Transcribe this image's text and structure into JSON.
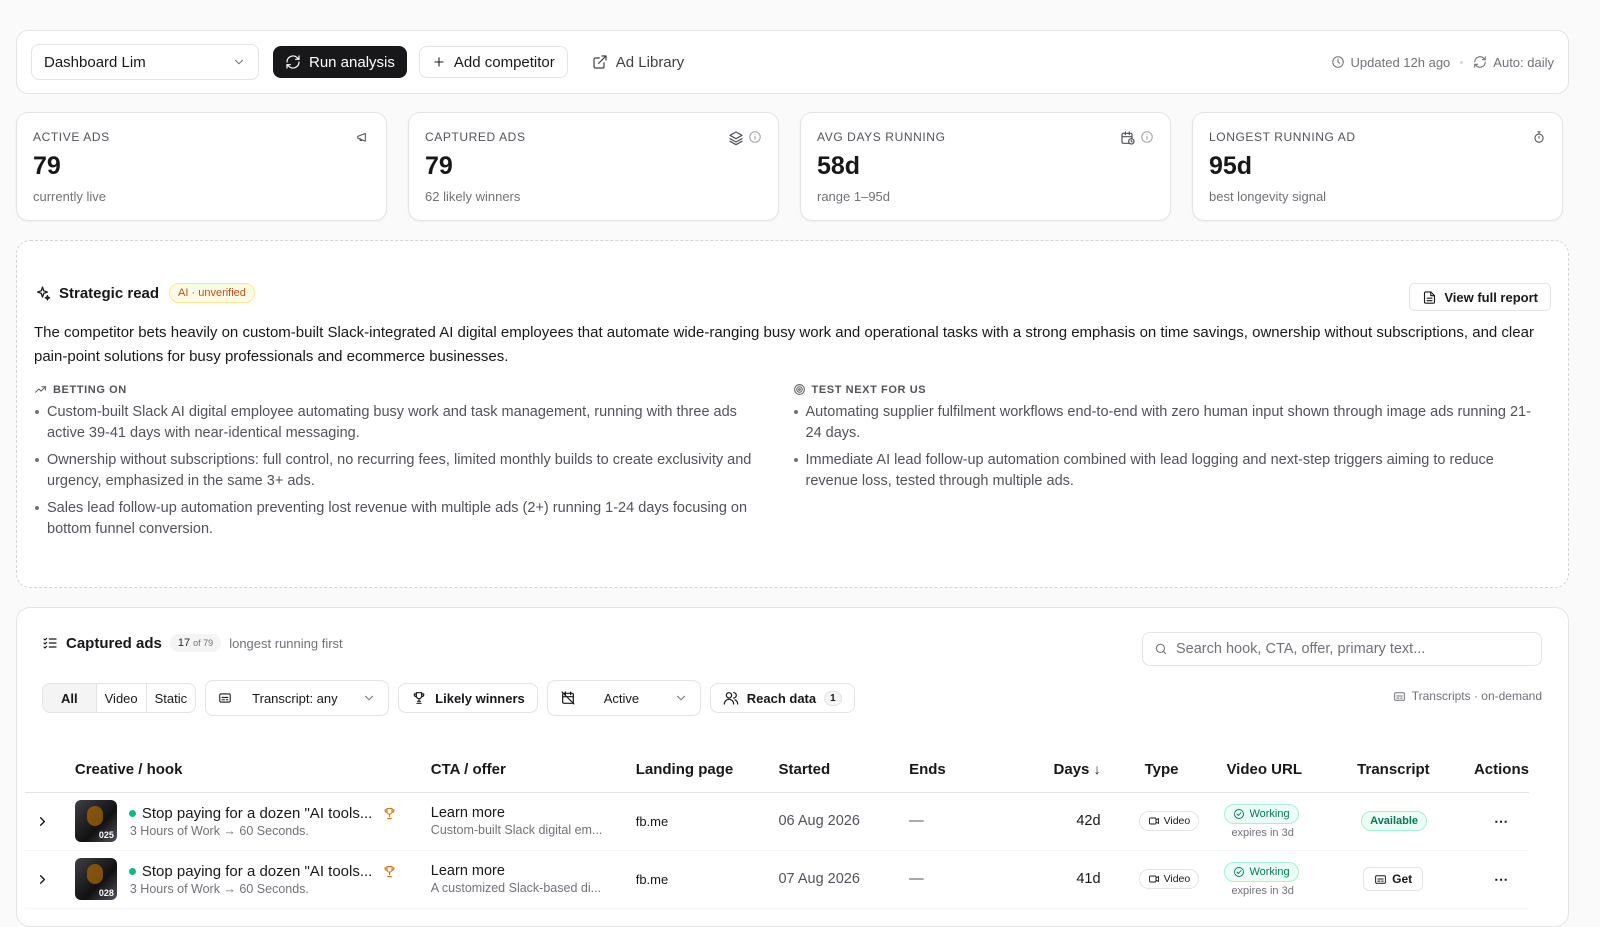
{
  "toolbar": {
    "dashboard_select": "Dashboard Lim",
    "run_analysis": "Run analysis",
    "add_competitor": "Add competitor",
    "ad_library": "Ad Library",
    "updated": "Updated 12h ago",
    "auto": "Auto: daily"
  },
  "stats": [
    {
      "label": "Active ads",
      "value": "79",
      "sub": "currently live",
      "icons": [
        "megaphone-icon"
      ]
    },
    {
      "label": "Captured ads",
      "value": "79",
      "sub": "62 likely winners",
      "icons": [
        "layers-icon",
        "info-icon"
      ]
    },
    {
      "label": "Avg days running",
      "value": "58d",
      "sub": "range 1–95d",
      "icons": [
        "calendar-clock-icon",
        "info-icon"
      ]
    },
    {
      "label": "Longest running ad",
      "value": "95d",
      "sub": "best longevity signal",
      "icons": [
        "stopwatch-icon"
      ]
    }
  ],
  "strategic": {
    "title": "Strategic read",
    "badge": "AI · unverified",
    "view_report": "View full report",
    "summary": "The competitor bets heavily on custom-built Slack-integrated AI digital employees that automate wide-ranging busy work and operational tasks with a strong emphasis on time savings, ownership without subscriptions, and clear pain-point solutions for busy professionals and ecommerce businesses.",
    "betting_on": {
      "label": "BETTING ON",
      "items": [
        "Custom-built Slack AI digital employee automating busy work and task management, running with three ads active 39-41 days with near-identical messaging.",
        "Ownership without subscriptions: full control, no recurring fees, limited monthly builds to create exclusivity and urgency, emphasized in the same 3+ ads.",
        "Sales lead follow-up automation preventing lost revenue with multiple ads (2+) running 1-24 days focusing on bottom funnel conversion."
      ]
    },
    "test_next": {
      "label": "TEST NEXT FOR US",
      "items": [
        "Automating supplier fulfilment workflows end-to-end with zero human input shown through image ads running 21-24 days.",
        "Immediate AI lead follow-up automation combined with lead logging and next-step triggers aiming to reduce revenue loss, tested through multiple ads."
      ]
    }
  },
  "captured": {
    "title": "Captured ads",
    "count": "17",
    "count_of": "of 79",
    "subtitle": "longest running first",
    "search_placeholder": "Search hook, CTA, offer, primary text...",
    "filters": {
      "all": "All",
      "video": "Video",
      "static": "Static",
      "transcript": "Transcript: any",
      "likely_winners": "Likely winners",
      "status": "Active",
      "reach": "Reach data",
      "reach_count": "1"
    },
    "transcripts_note": "Transcripts · on-demand",
    "columns": [
      "Creative / hook",
      "CTA / offer",
      "Landing page",
      "Started",
      "Ends",
      "Days",
      "Type",
      "Video URL",
      "Transcript",
      "Actions"
    ],
    "rows": [
      {
        "thumb_num": "025",
        "hook": "Stop paying for a dozen \"AI tools...",
        "hook_sub": "3 Hours of Work → 60 Seconds.",
        "cta": "Learn more",
        "cta_sub": "Custom-built Slack digital em...",
        "landing": "fb.me",
        "started": "06 Aug 2026",
        "ends": "—",
        "days": "42d",
        "type": "Video",
        "video_status": "Working",
        "expires": "expires in 3d",
        "transcript": "Available"
      },
      {
        "thumb_num": "028",
        "hook": "Stop paying for a dozen \"AI tools...",
        "hook_sub": "3 Hours of Work → 60 Seconds.",
        "cta": "Learn more",
        "cta_sub": "A customized Slack-based di...",
        "landing": "fb.me",
        "started": "07 Aug 2026",
        "ends": "—",
        "days": "41d",
        "type": "Video",
        "video_status": "Working",
        "expires": "expires in 3d",
        "transcript": "Get"
      }
    ]
  }
}
